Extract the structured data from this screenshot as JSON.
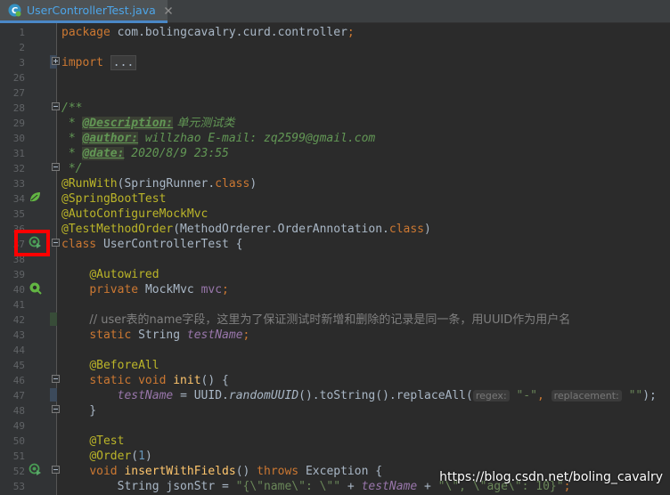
{
  "tab": {
    "title": "UserControllerTest.java",
    "icon": "java-class-icon",
    "accent": "#4a88c7"
  },
  "editor": {
    "lines": [
      {
        "n": "1",
        "tokens": [
          [
            "kw",
            "package "
          ],
          [
            "tx",
            "com.bolingcavalry.curd.controller"
          ],
          [
            "kw",
            ";"
          ]
        ]
      },
      {
        "n": "2",
        "tokens": []
      },
      {
        "n": "3",
        "tokens": [
          [
            "kw",
            "import "
          ],
          [
            "fold",
            "..."
          ]
        ]
      },
      {
        "n": "26",
        "tokens": []
      },
      {
        "n": "27",
        "tokens": []
      },
      {
        "n": "28",
        "tokens": [
          [
            "doc",
            "/**"
          ]
        ]
      },
      {
        "n": "29",
        "tokens": [
          [
            "doc",
            " * "
          ],
          [
            "dtag",
            "@Description:"
          ],
          [
            "doc",
            " 单元测试类"
          ]
        ]
      },
      {
        "n": "30",
        "tokens": [
          [
            "doc",
            " * "
          ],
          [
            "dtag",
            "@author:"
          ],
          [
            "doc",
            " willzhao E-mail: zq2599@gmail.com"
          ]
        ]
      },
      {
        "n": "31",
        "tokens": [
          [
            "doc",
            " * "
          ],
          [
            "dtag",
            "@date:"
          ],
          [
            "doc",
            " 2020/8/9 23:55"
          ]
        ]
      },
      {
        "n": "32",
        "tokens": [
          [
            "doc",
            " */"
          ]
        ]
      },
      {
        "n": "33",
        "tokens": [
          [
            "an",
            "@RunWith"
          ],
          [
            "tx",
            "(SpringRunner."
          ],
          [
            "kw",
            "class"
          ],
          [
            "tx",
            ")"
          ]
        ]
      },
      {
        "n": "34",
        "tokens": [
          [
            "an",
            "@SpringBootTest"
          ]
        ]
      },
      {
        "n": "35",
        "tokens": [
          [
            "an",
            "@AutoConfigureMockMvc"
          ]
        ]
      },
      {
        "n": "36",
        "tokens": [
          [
            "an",
            "@TestMethodOrder"
          ],
          [
            "tx",
            "(MethodOrderer.OrderAnnotation."
          ],
          [
            "kw",
            "class"
          ],
          [
            "tx",
            ")"
          ]
        ]
      },
      {
        "n": "37",
        "tokens": [
          [
            "kw",
            "class "
          ],
          [
            "tx",
            "UserControllerTest {"
          ]
        ]
      },
      {
        "n": "38",
        "tokens": []
      },
      {
        "n": "39",
        "tokens": [
          [
            "tx",
            "    "
          ],
          [
            "an",
            "@Autowired"
          ]
        ]
      },
      {
        "n": "40",
        "tokens": [
          [
            "tx",
            "    "
          ],
          [
            "kw",
            "private "
          ],
          [
            "tx",
            "MockMvc "
          ],
          [
            "fld",
            "mvc"
          ],
          [
            "kw",
            ";"
          ]
        ]
      },
      {
        "n": "41",
        "tokens": []
      },
      {
        "n": "42",
        "tokens": [
          [
            "tx",
            "    "
          ],
          [
            "cmt",
            "// user表的name字段，这里为了保证测试时新增和删除的记录是同一条，用UUID作为用户名"
          ]
        ]
      },
      {
        "n": "43",
        "tokens": [
          [
            "tx",
            "    "
          ],
          [
            "kw",
            "static "
          ],
          [
            "tx",
            "String "
          ],
          [
            "sfld",
            "testName"
          ],
          [
            "kw",
            ";"
          ]
        ]
      },
      {
        "n": "44",
        "tokens": []
      },
      {
        "n": "45",
        "tokens": [
          [
            "tx",
            "    "
          ],
          [
            "an",
            "@BeforeAll"
          ]
        ]
      },
      {
        "n": "46",
        "tokens": [
          [
            "tx",
            "    "
          ],
          [
            "kw",
            "static void "
          ],
          [
            "mth",
            "init"
          ],
          [
            "tx",
            "() {"
          ]
        ]
      },
      {
        "n": "47",
        "tokens": [
          [
            "tx",
            "        "
          ],
          [
            "sfld",
            "testName"
          ],
          [
            "tx",
            " = UUID."
          ],
          [
            "smth",
            "randomUUID"
          ],
          [
            "tx",
            "().toString().replaceAll("
          ],
          [
            "hint",
            "regex:"
          ],
          [
            "tx",
            " "
          ],
          [
            "str",
            "\"-\""
          ],
          [
            "kw",
            ", "
          ],
          [
            "hint",
            "replacement:"
          ],
          [
            "tx",
            " "
          ],
          [
            "str",
            "\"\""
          ],
          [
            "tx",
            ");"
          ]
        ]
      },
      {
        "n": "48",
        "tokens": [
          [
            "tx",
            "    }"
          ]
        ]
      },
      {
        "n": "49",
        "tokens": []
      },
      {
        "n": "50",
        "tokens": [
          [
            "tx",
            "    "
          ],
          [
            "an",
            "@Test"
          ]
        ]
      },
      {
        "n": "51",
        "tokens": [
          [
            "tx",
            "    "
          ],
          [
            "an",
            "@Order"
          ],
          [
            "tx",
            "("
          ],
          [
            "num",
            "1"
          ],
          [
            "tx",
            ")"
          ]
        ]
      },
      {
        "n": "52",
        "tokens": [
          [
            "tx",
            "    "
          ],
          [
            "kw",
            "void "
          ],
          [
            "mth",
            "insertWithFields"
          ],
          [
            "tx",
            "() "
          ],
          [
            "kw",
            "throws "
          ],
          [
            "tx",
            "Exception {"
          ]
        ]
      },
      {
        "n": "53",
        "tokens": [
          [
            "tx",
            "        String jsonStr = "
          ],
          [
            "str",
            "\"{\\\"name\\\": \\\"\""
          ],
          [
            "tx",
            " + "
          ],
          [
            "sfld",
            "testName"
          ],
          [
            "tx",
            " + "
          ],
          [
            "str",
            "\"\\\", \\\"age\\\": 10}\""
          ],
          [
            "kw",
            ";"
          ]
        ]
      }
    ]
  },
  "gutter_icons": [
    {
      "line": "34",
      "icon": "spring-bean-icon"
    },
    {
      "line": "37",
      "icon": "run-test-class-icon"
    },
    {
      "line": "40",
      "icon": "autowired-bean-icon"
    },
    {
      "line": "52",
      "icon": "run-test-method-icon"
    }
  ],
  "watermark": "https://blog.csdn.net/boling_cavalry"
}
